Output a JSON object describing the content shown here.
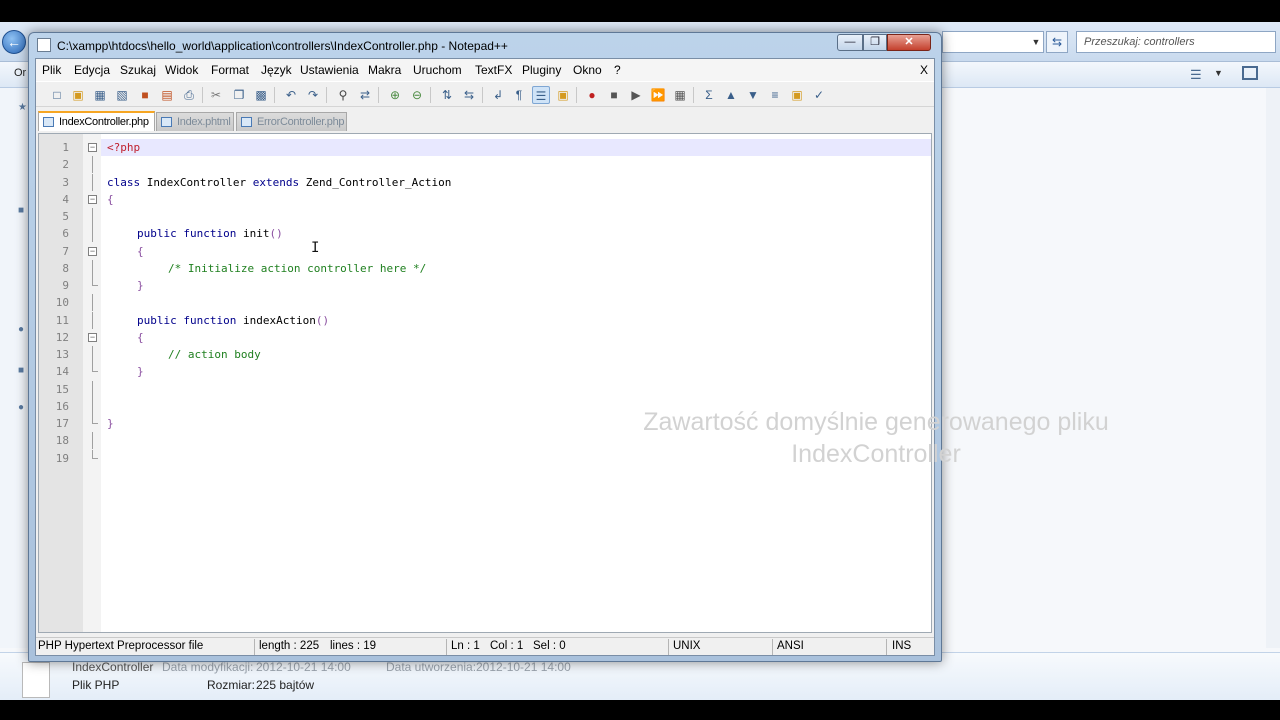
{
  "window": {
    "title": "C:\\xampp\\htdocs\\hello_world\\application\\controllers\\IndexController.php - Notepad++"
  },
  "menu": [
    "Plik",
    "Edycja",
    "Szukaj",
    "Widok",
    "Format",
    "Język",
    "Ustawienia",
    "Makra",
    "Uruchom",
    "TextFX",
    "Pluginy",
    "Okno",
    "?"
  ],
  "menu_close": "X",
  "tabs": [
    {
      "label": "IndexController.php",
      "active": true
    },
    {
      "label": "Index.phtml",
      "active": false
    },
    {
      "label": "ErrorController.php",
      "active": false
    }
  ],
  "editor": {
    "line_numbers": [
      "1",
      "2",
      "3",
      "4",
      "5",
      "6",
      "7",
      "8",
      "9",
      "10",
      "11",
      "12",
      "13",
      "14",
      "15",
      "16",
      "17",
      "18",
      "19"
    ],
    "lines": {
      "l1": "<?php",
      "l3_class": "class",
      "l3_name": " IndexController ",
      "l3_extends": "extends",
      "l3_parent": " Zend_Controller_Action",
      "l4": "{",
      "l6_kw": "public function",
      "l6_name": " init",
      "l6_paren": "()",
      "l7": "{",
      "l8": "/* Initialize action controller here */",
      "l9": "}",
      "l11_kw": "public function",
      "l11_name": " indexAction",
      "l11_paren": "()",
      "l12": "{",
      "l13": "// action body",
      "l14": "}",
      "l17": "}"
    },
    "overlay_line1": "Zawartość domyślnie generowanego pliku",
    "overlay_line2": "IndexController"
  },
  "statusbar": {
    "filetype": "PHP Hypertext Preprocessor file",
    "length": "length : 225",
    "lines": "lines : 19",
    "ln": "Ln : 1",
    "col": "Col : 1",
    "sel": "Sel : 0",
    "eol": "UNIX",
    "encoding": "ANSI",
    "mode": "INS"
  },
  "explorer": {
    "search_placeholder": "Przeszukaj: controllers",
    "left_label": "Or",
    "details": {
      "name": "IndexController",
      "modified_label": "Data modyfikacji:",
      "modified_value": "2012-10-21 14:00",
      "created_label": "Data utworzenia:",
      "created_value": "2012-10-21 14:00",
      "type": "Plik PHP",
      "size_label": "Rozmiar:",
      "size_value": "225 bajtów"
    }
  },
  "icons": {
    "back": "back-arrow-icon",
    "refresh": "refresh-icon"
  }
}
